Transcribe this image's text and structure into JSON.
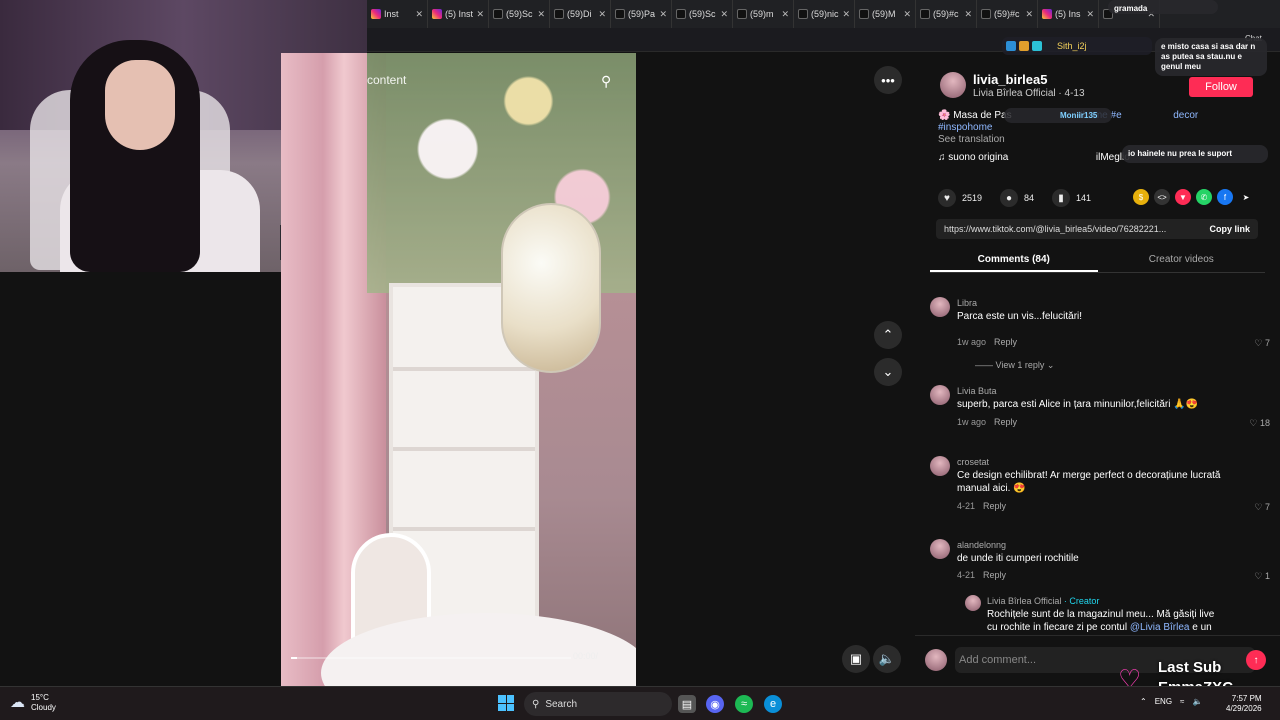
{
  "browser": {
    "tabs": [
      {
        "label": "Inst",
        "icon": "instagram-icon"
      },
      {
        "label": "(5) Inst",
        "icon": "instagram-icon"
      },
      {
        "label": "(59)Sc",
        "icon": "tiktok-icon"
      },
      {
        "label": "(59)Di",
        "icon": "tiktok-icon"
      },
      {
        "label": "(59)Pa",
        "icon": "tiktok-icon"
      },
      {
        "label": "(59)Sc",
        "icon": "tiktok-icon"
      },
      {
        "label": "(59)m",
        "icon": "tiktok-icon"
      },
      {
        "label": "(59)nic",
        "icon": "tiktok-icon"
      },
      {
        "label": "(59)M",
        "icon": "tiktok-icon"
      },
      {
        "label": "(59)#c",
        "icon": "tiktok-icon"
      },
      {
        "label": "(59)#c",
        "icon": "tiktok-icon"
      },
      {
        "label": "(5) Ins",
        "icon": "instagram-icon"
      },
      {
        "label": "",
        "icon": "tiktok-icon"
      }
    ]
  },
  "video": {
    "search_placeholder": "content",
    "time": "00:00/",
    "progress": 0.02
  },
  "post": {
    "username": "livia_birlea5",
    "nickname": "Livia Bîrlea Official · 4-13",
    "follow_label": "Follow",
    "desc_start": "🌸 Masa de Pas",
    "tags": "#home #e",
    "tag_end": "decor",
    "tag_line2": "#inspohome",
    "see_translation": "See translation",
    "sound": "suono origina",
    "sound_end": "ilMeglio",
    "likes": "2519",
    "comments": "84",
    "saves": "141",
    "link": "https://www.tiktok.com/@livia_birlea5/video/76282221...",
    "copy_link": "Copy link",
    "tab_comments": "Comments (84)",
    "tab_creator": "Creator videos"
  },
  "comments": [
    {
      "user": "Libra",
      "text": "Parca este un vis...felucitări!",
      "time": "1w ago",
      "reply": "Reply",
      "likes": "7",
      "view_reply": "View 1 reply"
    },
    {
      "user": "Livia Buta",
      "text": "superb, parca esti Alice in țara minunilor,felicitări 🙏😍",
      "time": "1w ago",
      "reply": "Reply",
      "likes": "18"
    },
    {
      "user": "crosetat",
      "text": "Ce design echilibrat! Ar merge perfect o decorațiune lucrată manual aici. 😍",
      "time": "4-21",
      "reply": "Reply",
      "likes": "7"
    },
    {
      "user": "alandelonng",
      "text": "de unde iti cumperi rochitile",
      "time": "4-21",
      "reply": "Reply",
      "likes": "1"
    },
    {
      "user": "Livia Bîrlea Official",
      "creator": "· Creator",
      "text": "Rochițele sunt de la magazinul meu... Mă găsiți live cu rochite in fiecare zi pe contul ",
      "mention": "@Livia Bîrlea",
      "text_end": " e un"
    }
  ],
  "comment_input": {
    "placeholder": "Add comment..."
  },
  "overlay": {
    "chat_label": "Chat",
    "chat_user": "Sith_i2j",
    "bubble1": "e misto casa si asa dar n as putea sa stau.nu e genul meu",
    "bubble2": "io hainele nu prea le suport",
    "top_text": "gramada",
    "pill_user": "Moniir135",
    "last_sub_title": "Last Sub",
    "last_sub_name": "EmmaZXC"
  },
  "taskbar": {
    "temp": "15°C",
    "weather": "Cloudy",
    "search_label": "Search",
    "lang": "ENG",
    "time": "7:57 PM",
    "date": "4/29/2026"
  },
  "colors": {
    "accent": "#fe2c55",
    "creator": "#20d5ec",
    "tag": "#8fb8ff"
  }
}
